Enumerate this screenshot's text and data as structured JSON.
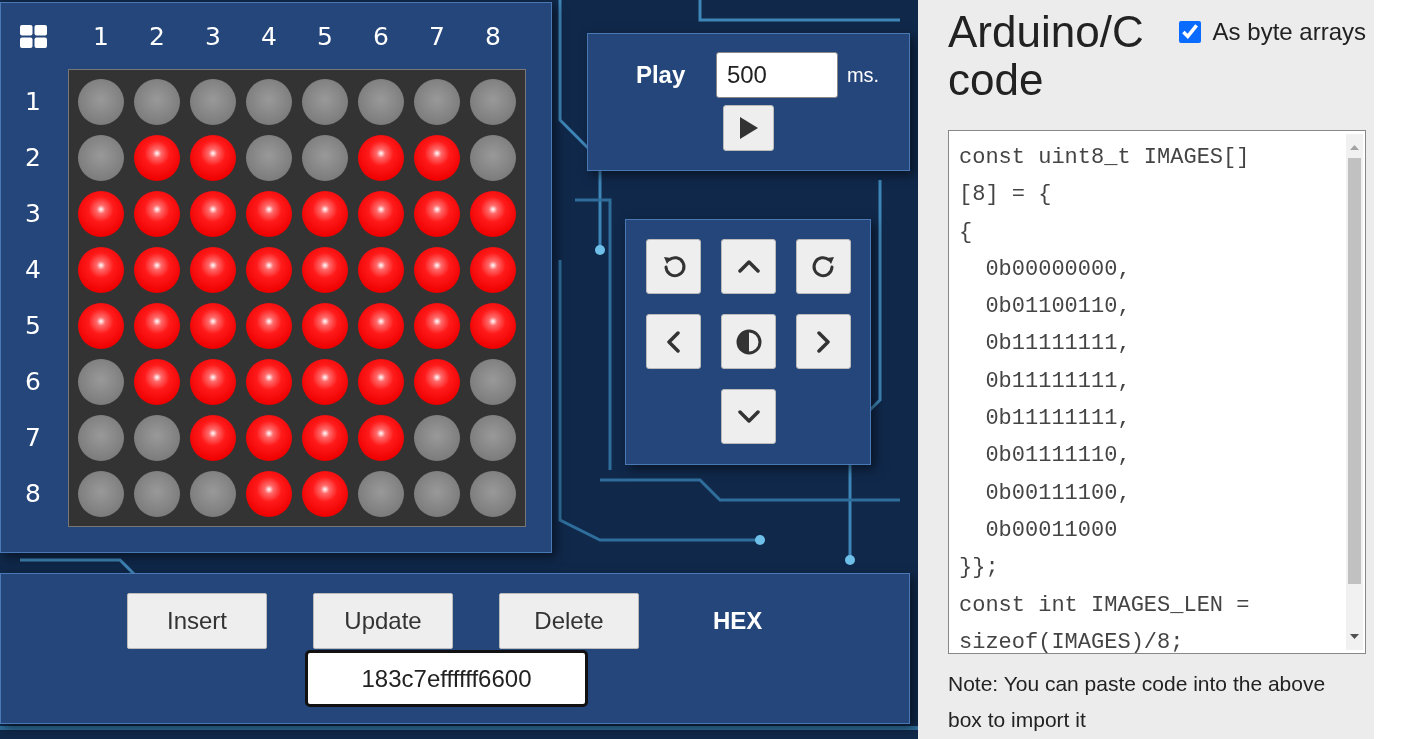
{
  "matrix": {
    "columns": [
      "1",
      "2",
      "3",
      "4",
      "5",
      "6",
      "7",
      "8"
    ],
    "rows": [
      {
        "label": "1",
        "leds": [
          false,
          false,
          false,
          false,
          false,
          false,
          false,
          false
        ]
      },
      {
        "label": "2",
        "leds": [
          false,
          true,
          true,
          false,
          false,
          true,
          true,
          false
        ]
      },
      {
        "label": "3",
        "leds": [
          true,
          true,
          true,
          true,
          true,
          true,
          true,
          true
        ]
      },
      {
        "label": "4",
        "leds": [
          true,
          true,
          true,
          true,
          true,
          true,
          true,
          true
        ]
      },
      {
        "label": "5",
        "leds": [
          true,
          true,
          true,
          true,
          true,
          true,
          true,
          true
        ]
      },
      {
        "label": "6",
        "leds": [
          false,
          true,
          true,
          true,
          true,
          true,
          true,
          false
        ]
      },
      {
        "label": "7",
        "leds": [
          false,
          false,
          true,
          true,
          true,
          true,
          false,
          false
        ]
      },
      {
        "label": "8",
        "leds": [
          false,
          false,
          false,
          true,
          true,
          false,
          false,
          false
        ]
      }
    ]
  },
  "player": {
    "label": "Play",
    "interval": "500",
    "unit": "ms."
  },
  "transform_buttons": [
    {
      "kind": "rotate-left"
    },
    {
      "kind": "up"
    },
    {
      "kind": "rotate-right"
    },
    {
      "kind": "left"
    },
    {
      "kind": "invert"
    },
    {
      "kind": "right"
    },
    {
      "kind": "down"
    }
  ],
  "frame_buttons": [
    "Insert",
    "Update",
    "Delete"
  ],
  "hex": {
    "label": "HEX",
    "value": "183c7effffff6600"
  },
  "code_panel": {
    "title": "Arduino/C code",
    "byte_arrays": {
      "label": "As byte arrays",
      "checked": true
    },
    "code_lines": [
      "const uint8_t IMAGES[]",
      "[8] = {",
      "{",
      "  0b00000000,",
      "  0b01100110,",
      "  0b11111111,",
      "  0b11111111,",
      "  0b11111111,",
      "  0b01111110,",
      "  0b00111100,",
      "  0b00011000",
      "}};",
      "const int IMAGES_LEN =",
      "sizeof(IMAGES)/8;"
    ],
    "note": "Note: You can paste code into the above box to import it"
  }
}
